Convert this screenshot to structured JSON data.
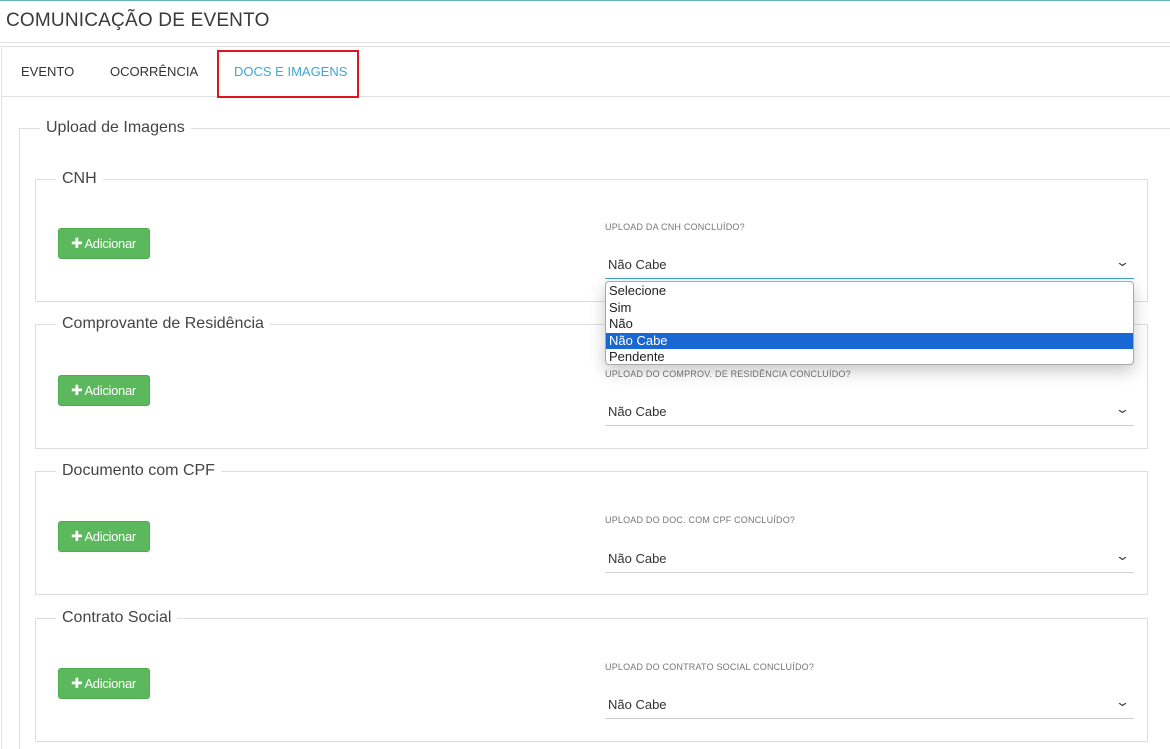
{
  "header": {
    "title": "COMUNICAÇÃO DE EVENTO"
  },
  "tabs": [
    {
      "label": "EVENTO",
      "active": false
    },
    {
      "label": "OCORRÊNCIA",
      "active": false
    },
    {
      "label": "DOCS E IMAGENS",
      "active": true
    }
  ],
  "upload": {
    "legend": "Upload de Imagens",
    "add_button_label": "Adicionar",
    "sections": [
      {
        "legend": "CNH",
        "field_label": "UPLOAD DA CNH CONCLUÍDO?",
        "value": "Não Cabe"
      },
      {
        "legend": "Comprovante de Residência",
        "field_label": "UPLOAD DO COMPROV. DE RESIDÊNCIA CONCLUÍDO?",
        "value": "Não Cabe"
      },
      {
        "legend": "Documento com CPF",
        "field_label": "UPLOAD DO DOC. COM CPF CONCLUÍDO?",
        "value": "Não Cabe"
      },
      {
        "legend": "Contrato Social",
        "field_label": "UPLOAD DO CONTRATO SOCIAL CONCLUÍDO?",
        "value": "Não Cabe"
      }
    ]
  },
  "dropdown": {
    "options": [
      "Selecione",
      "Sim",
      "Não",
      "Não Cabe",
      "Pendente"
    ],
    "selected": "Não Cabe"
  },
  "colors": {
    "accent": "#3ea7d4",
    "button_green": "#5cb85c",
    "highlight_red": "#e0141c",
    "option_selected": "#1967d2"
  },
  "icons": {
    "add": "plus-icon",
    "select": "chevron-down-icon"
  }
}
